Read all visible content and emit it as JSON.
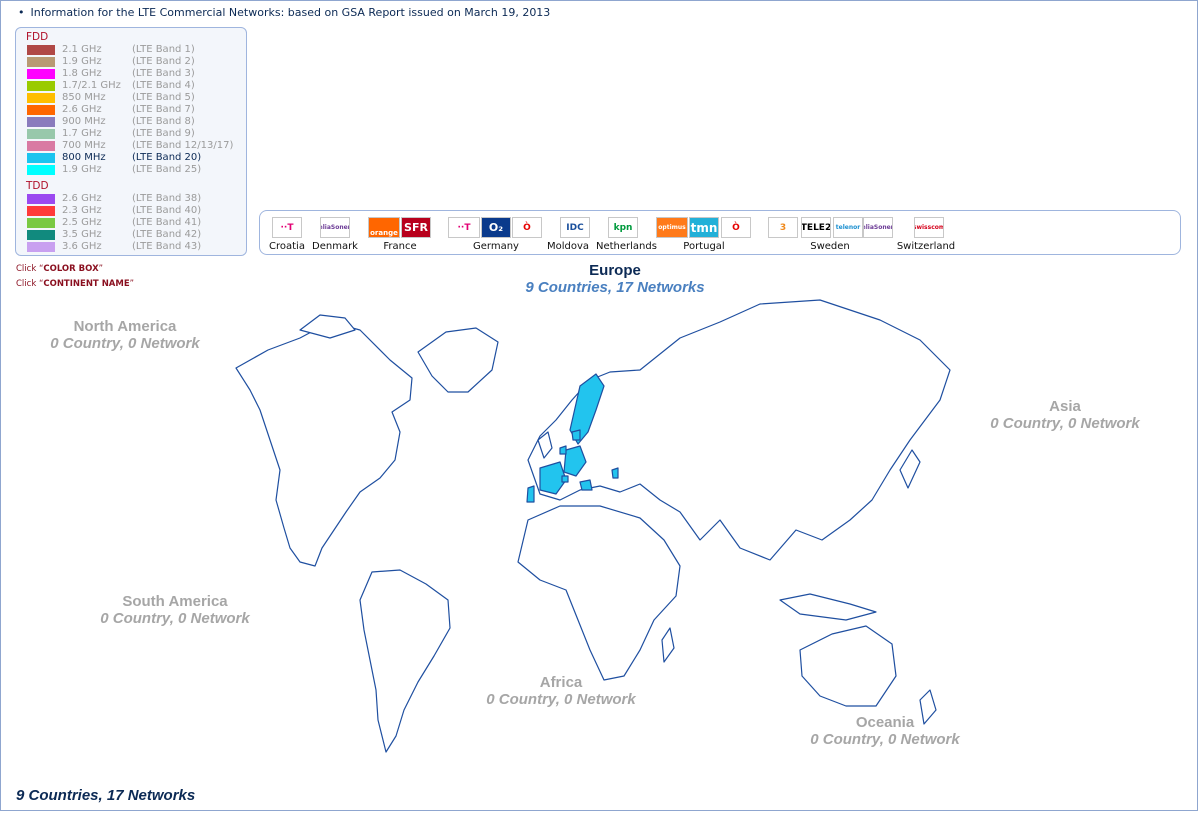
{
  "header": {
    "text": "Information for the LTE Commercial Networks: based on GSA Report issued on March 19, 2013"
  },
  "legend": {
    "fdd_title": "FDD",
    "tdd_title": "TDD",
    "fdd": [
      {
        "freq": "2.1 GHz",
        "band": "(LTE Band 1)",
        "color": "#b04846",
        "active": false
      },
      {
        "freq": "1.9 GHz",
        "band": "(LTE Band 2)",
        "color": "#b89a74",
        "active": false
      },
      {
        "freq": "1.8 GHz",
        "band": "(LTE Band 3)",
        "color": "#ff00ff",
        "active": false
      },
      {
        "freq": "1.7/2.1 GHz",
        "band": "(LTE Band 4)",
        "color": "#9acb00",
        "active": false
      },
      {
        "freq": "850 MHz",
        "band": "(LTE Band 5)",
        "color": "#ffbe00",
        "active": false
      },
      {
        "freq": "2.6 GHz",
        "band": "(LTE Band 7)",
        "color": "#ff6600",
        "active": false
      },
      {
        "freq": "900 MHz",
        "band": "(LTE Band 8)",
        "color": "#8a7bbd",
        "active": false
      },
      {
        "freq": "1.7 GHz",
        "band": "(LTE Band 9)",
        "color": "#98c8ab",
        "active": false
      },
      {
        "freq": "700 MHz",
        "band": "(LTE Band 12/13/17)",
        "color": "#d97aa3",
        "active": false
      },
      {
        "freq": "800 MHz",
        "band": "(LTE Band 20)",
        "color": "#1bc4ef",
        "active": true
      },
      {
        "freq": "1.9 GHz",
        "band": "(LTE Band 25)",
        "color": "#00ffff",
        "active": false
      }
    ],
    "tdd": [
      {
        "freq": "2.6 GHz",
        "band": "(LTE Band 38)",
        "color": "#9b49f0",
        "active": false
      },
      {
        "freq": "2.3 GHz",
        "band": "(LTE Band 40)",
        "color": "#ff3a3a",
        "active": false
      },
      {
        "freq": "2.5 GHz",
        "band": "(LTE Band 41)",
        "color": "#7ac943",
        "active": false
      },
      {
        "freq": "3.5 GHz",
        "band": "(LTE Band 42)",
        "color": "#118a7e",
        "active": false
      },
      {
        "freq": "3.6 GHz",
        "band": "(LTE Band 43)",
        "color": "#c9a0f0",
        "active": false
      }
    ]
  },
  "hints": {
    "color_box_prefix": "Click “",
    "color_box": "COLOR BOX",
    "color_box_suffix": "”",
    "continent_prefix": "Click “",
    "continent": "CONTINENT NAME",
    "continent_suffix": "”"
  },
  "operators": {
    "countries": [
      "Croatia",
      "Denmark",
      "France",
      "Germany",
      "Moldova",
      "Netherlands",
      "Portugal",
      "Sweden",
      "Switzerland"
    ],
    "logos": [
      {
        "name": "T-Mobile",
        "text": "··T",
        "color": "#e20074"
      },
      {
        "name": "TeliaSonera",
        "text": "TeliaSonera",
        "color": "#6c3b96"
      },
      {
        "name": "Orange",
        "text": "orange",
        "color": "#ff6600"
      },
      {
        "name": "SFR",
        "text": "SFR",
        "color": "#e2001a"
      },
      {
        "name": "T-Mobile",
        "text": "··T",
        "color": "#e20074"
      },
      {
        "name": "O2",
        "text": "O₂",
        "color": "#0a3a8c"
      },
      {
        "name": "Vodafone",
        "text": "Ò",
        "color": "#e60000"
      },
      {
        "name": "IDC",
        "text": "IDC",
        "color": "#1a4f9c"
      },
      {
        "name": "KPN",
        "text": "kpn",
        "color": "#009a3d"
      },
      {
        "name": "Optimus",
        "text": "optimus",
        "color": "#ff7a1a"
      },
      {
        "name": "TMN",
        "text": "tmn",
        "color": "#22b0d8"
      },
      {
        "name": "Vodafone",
        "text": "Ò",
        "color": "#e60000"
      },
      {
        "name": "3",
        "text": "3",
        "color": "#f08a1d"
      },
      {
        "name": "Tele2",
        "text": "TELE2",
        "color": "#000000"
      },
      {
        "name": "Telenor",
        "text": "telenor",
        "color": "#1a8fd0"
      },
      {
        "name": "TeliaSonera",
        "text": "TeliaSonera",
        "color": "#6c3b96"
      },
      {
        "name": "Swisscom",
        "text": "swisscom",
        "color": "#d4001a"
      }
    ]
  },
  "continents": {
    "europe": {
      "name": "Europe",
      "stats": "9 Countries, 17 Networks"
    },
    "north_america": {
      "name": "North America",
      "stats": "0 Country, 0 Network"
    },
    "south_america": {
      "name": "South America",
      "stats": "0 Country, 0 Network"
    },
    "asia": {
      "name": "Asia",
      "stats": "0 Country, 0 Network"
    },
    "africa": {
      "name": "Africa",
      "stats": "0 Country, 0 Network"
    },
    "oceania": {
      "name": "Oceania",
      "stats": "0 Country, 0 Network"
    }
  },
  "total": "9 Countries, 17 Networks",
  "colors": {
    "accent": "#0c2a55",
    "highlight": "#22c4ee",
    "border": "#9fb5de"
  }
}
